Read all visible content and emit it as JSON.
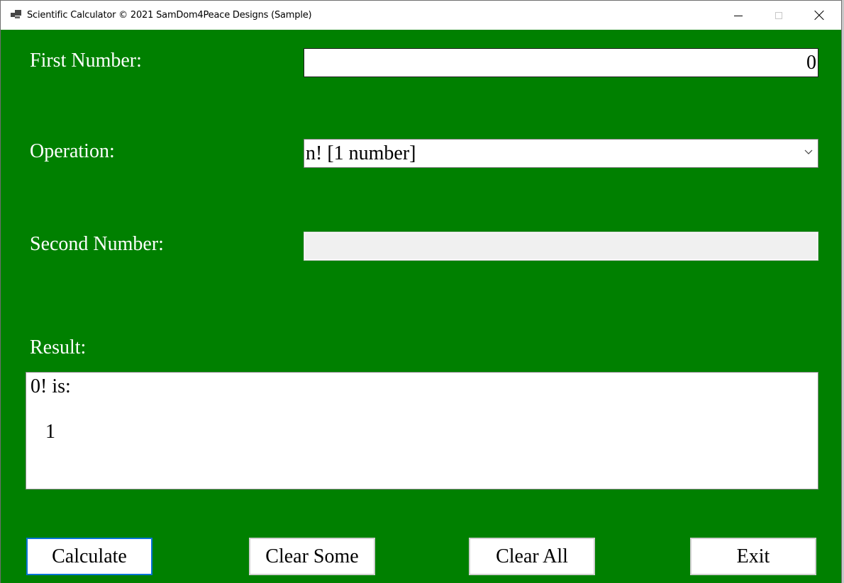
{
  "window": {
    "title": "Scientific Calculator © 2021 SamDom4Peace Designs (Sample)",
    "icon": "app-window-icon",
    "controls": {
      "minimize": "minimize-icon",
      "maximize": "maximize-icon",
      "close": "close-icon"
    }
  },
  "form": {
    "first_number": {
      "label": "First Number:",
      "value": "0"
    },
    "operation": {
      "label": "Operation:",
      "selected": "n! [1 number]",
      "dropdown_icon": "chevron-down-icon"
    },
    "second_number": {
      "label": "Second Number:",
      "value": "",
      "disabled": true
    },
    "result": {
      "label": "Result:",
      "text": "0! is:\n\n   1"
    }
  },
  "buttons": {
    "calculate": "Calculate",
    "clear_some": "Clear Some",
    "clear_all": "Clear All",
    "exit": "Exit"
  },
  "colors": {
    "background": "#008000",
    "label_text": "#ffffff",
    "focus_border": "#0a74d8",
    "disabled_field": "#f0f0f0"
  }
}
